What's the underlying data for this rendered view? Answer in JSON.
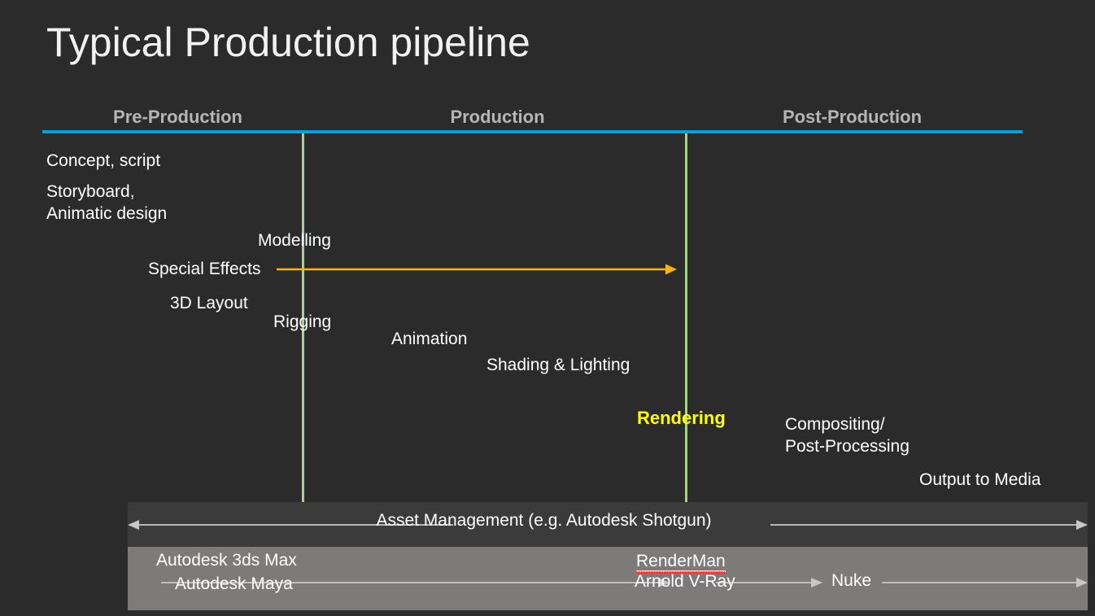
{
  "slide": {
    "title": "Typical Production pipeline",
    "background_color": "#2b2b2b"
  },
  "phases": {
    "rule_color": "#00a3e0",
    "divider_color": "#a9d18e",
    "items": [
      {
        "label": "Pre-Production"
      },
      {
        "label": "Production"
      },
      {
        "label": "Post-Production"
      }
    ]
  },
  "stages": [
    {
      "label": "Concept, script"
    },
    {
      "label": "Storyboard,\nAnimatic design"
    },
    {
      "label": "Modelling"
    },
    {
      "label": "Special Effects"
    },
    {
      "label": "3D Layout"
    },
    {
      "label": "Rigging"
    },
    {
      "label": "Animation"
    },
    {
      "label": "Shading & Lighting"
    },
    {
      "label": "Rendering",
      "color": "#ffff00",
      "emphasis": "bold"
    },
    {
      "label": "Compositing/\nPost-Processing"
    },
    {
      "label": "Output to Media"
    }
  ],
  "special_effects_arrow": {
    "color": "#ffb310",
    "direction": "right"
  },
  "asset_bar": {
    "label": "Asset Management (e.g. Autodesk Shotgun)",
    "arrow_direction": "both",
    "background_color": "#3b3b3b",
    "arrow_color": "#c8c8c8"
  },
  "software_bar": {
    "background_color": "#7d7b79",
    "arrow_color": "#c8c8c8",
    "items": [
      {
        "label": "Autodesk 3ds Max"
      },
      {
        "label": "Autodesk Maya"
      },
      {
        "label": "RenderMan",
        "spell_error": true
      },
      {
        "label": "Arnold V-Ray"
      },
      {
        "label": "Nuke"
      }
    ]
  }
}
